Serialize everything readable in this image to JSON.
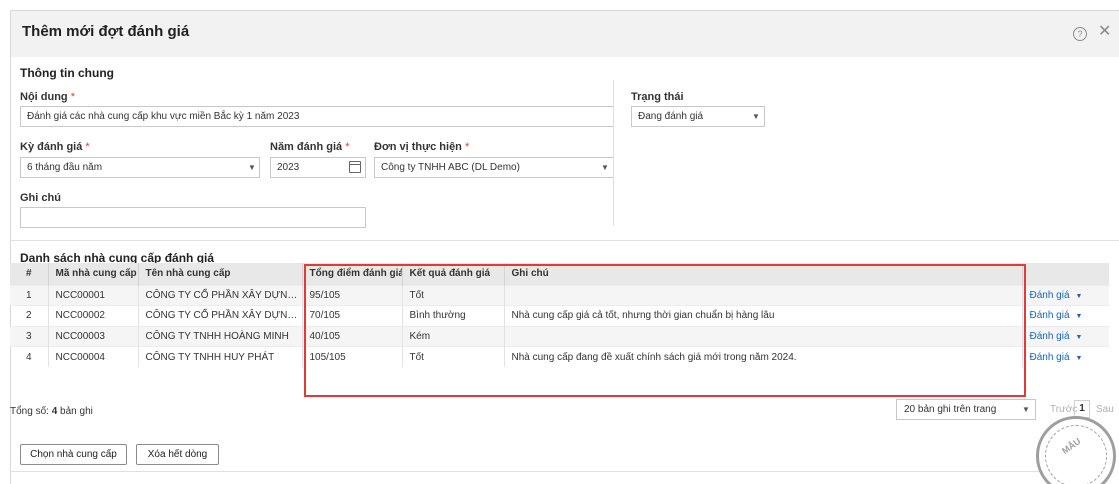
{
  "dialog": {
    "title": "Thêm mới đợt đánh giá",
    "help_icon": "question-circle-icon",
    "close_icon": "close-icon",
    "help_glyph": "?",
    "close_glyph": "✕"
  },
  "general": {
    "section_title": "Thông tin chung",
    "content_label": "Nội dung",
    "content_value": "Đánh giá các nhà cung cấp khu vực miền Bắc kỳ 1 năm 2023",
    "status_label": "Trạng thái",
    "status_value": "Đang đánh giá",
    "period_label": "Kỳ đánh giá",
    "period_value": "6 tháng đầu năm",
    "year_label": "Năm đánh giá",
    "year_value": "2023",
    "unit_label": "Đơn vị thực hiện",
    "unit_value": "Công ty TNHH ABC (DL Demo)",
    "note_label": "Ghi chú",
    "note_value": "",
    "required_mark": "*"
  },
  "suppliers": {
    "section_title": "Danh sách nhà cung cấp đánh giá",
    "columns": [
      "#",
      "Mã nhà cung cấp",
      "Tên nhà cung cấp",
      "Tổng điểm đánh giá",
      "Kết quả đánh giá",
      "Ghi chú",
      ""
    ],
    "rows": [
      {
        "index": "1",
        "code": "NCC00001",
        "name": "CÔNG TY CỔ PHẦN XÂY DỰNG & ...",
        "score": "95/105",
        "result": "Tốt",
        "note": "",
        "action": "Đánh giá"
      },
      {
        "index": "2",
        "code": "NCC00002",
        "name": "CÔNG TY CỔ PHẦN XÂY DỰNG & ...",
        "score": "70/105",
        "result": "Bình thường",
        "note": "Nhà cung cấp giá cả tốt, nhưng thời gian chuẩn bị hàng lâu",
        "action": "Đánh giá"
      },
      {
        "index": "3",
        "code": "NCC00003",
        "name": "CÔNG TY TNHH HOÀNG MINH",
        "score": "40/105",
        "result": "Kém",
        "note": "",
        "action": "Đánh giá"
      },
      {
        "index": "4",
        "code": "NCC00004",
        "name": "CÔNG TY TNHH HUY PHÁT",
        "score": "105/105",
        "result": "Tốt",
        "note": "Nhà cung cấp đang đề xuất chính sách giá mới trong năm 2024.",
        "action": "Đánh giá"
      }
    ],
    "dropdown_caret": "▼"
  },
  "footer": {
    "total_prefix": "Tổng số: ",
    "total_count": "4",
    "total_suffix": " bản ghi",
    "page_size": "20 bản ghi trên trang",
    "prev": "Trước",
    "page": "1",
    "next": "Sau",
    "choose_supplier": "Chọn nhà cung cấp",
    "delete_all_rows": "Xóa hết dòng"
  },
  "stamp": {
    "text": "MẪU"
  },
  "colors": {
    "accent_link": "#1565c0",
    "highlight_border": "#e53935",
    "header_bg": "#f2f2f2"
  }
}
